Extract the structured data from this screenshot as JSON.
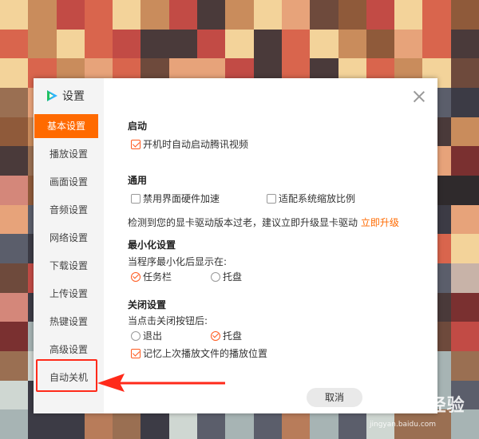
{
  "dialog": {
    "title": "设置",
    "close_icon": "close-icon",
    "cancel_label": "取消"
  },
  "sidebar": {
    "items": [
      {
        "label": "基本设置",
        "active": true
      },
      {
        "label": "播放设置"
      },
      {
        "label": "画面设置"
      },
      {
        "label": "音频设置"
      },
      {
        "label": "网络设置"
      },
      {
        "label": "下载设置"
      },
      {
        "label": "上传设置"
      },
      {
        "label": "热键设置"
      },
      {
        "label": "高级设置"
      },
      {
        "label": "自动关机",
        "highlighted": true
      }
    ]
  },
  "startup": {
    "heading": "启动",
    "autostart": {
      "label": "开机时自动启动腾讯视频",
      "checked": true
    }
  },
  "general": {
    "heading": "通用",
    "disable_hw": {
      "label": "禁用界面硬件加速",
      "checked": false
    },
    "adapt_scale": {
      "label": "适配系统缩放比例",
      "checked": false
    },
    "driver_notice": "检测到您的显卡驱动版本过老，建议立即升级显卡驱动",
    "upgrade_link": "立即升级"
  },
  "minimize": {
    "heading": "最小化设置",
    "prompt": "当程序最小化后显示在:",
    "taskbar": {
      "label": "任务栏",
      "checked": true
    },
    "tray": {
      "label": "托盘",
      "checked": false
    }
  },
  "close": {
    "heading": "关闭设置",
    "prompt": "当点击关闭按钮后:",
    "exit": {
      "label": "退出",
      "checked": false
    },
    "tray": {
      "label": "托盘",
      "checked": true
    },
    "remember": {
      "label": "记忆上次播放文件的播放位置",
      "checked": true
    }
  },
  "watermark": {
    "text": "Baidu经验",
    "sub": "jingyan.baidu.com"
  },
  "colors": {
    "accent": "#ff6a00",
    "highlight_red": "#ff2a1a"
  }
}
